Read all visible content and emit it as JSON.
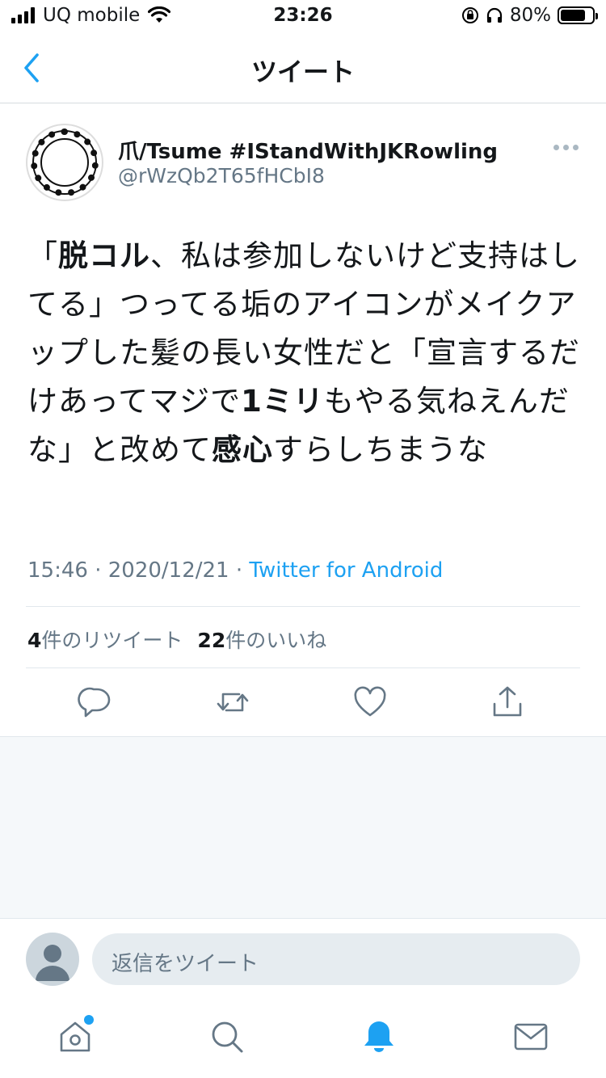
{
  "status_bar": {
    "carrier": "UQ mobile",
    "time": "23:26",
    "battery": "80%",
    "battery_level": 0.8
  },
  "header": {
    "title": "ツイート"
  },
  "tweet": {
    "author_name": "爪/Tsume #IStandWithJKRowling",
    "author_handle": "@rWzQb2T65fHCbI8",
    "text_segments": [
      {
        "text": "「",
        "bold": false
      },
      {
        "text": "脱コル",
        "bold": true
      },
      {
        "text": "、私は参加しないけど支持はしてる」つってる垢のアイコンがメイクアップした髪の長い女性だと「宣言するだけあってマジで",
        "bold": false
      },
      {
        "text": "1ミリ",
        "bold": true
      },
      {
        "text": "もやる気ねえんだな」と改めて",
        "bold": false
      },
      {
        "text": "感心",
        "bold": true
      },
      {
        "text": "すらしちまうな",
        "bold": false
      }
    ],
    "time": "15:46",
    "date": "2020/12/21",
    "source": "Twitter for Android",
    "retweets_count": "4",
    "retweets_label": "件のリツイート",
    "likes_count": "22",
    "likes_label": "件のいいね"
  },
  "reply": {
    "placeholder": "返信をツイート"
  },
  "colors": {
    "accent": "#1da1f2",
    "secondary_text": "#657786",
    "icon_gray": "#657786"
  }
}
